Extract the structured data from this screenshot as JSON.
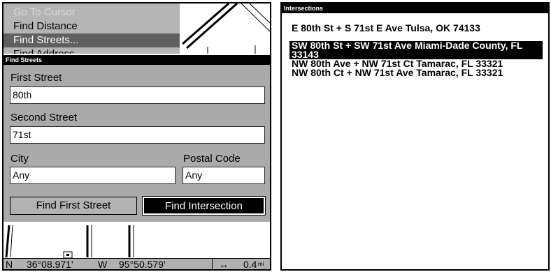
{
  "left": {
    "menu": {
      "items": [
        {
          "label": "Go To Cursor",
          "state": "disabled"
        },
        {
          "label": "Find Distance",
          "state": "normal"
        },
        {
          "label": "Find Streets...",
          "state": "selected"
        },
        {
          "label": "Find Address",
          "state": "normal"
        }
      ]
    },
    "dialog": {
      "title": "Find Streets",
      "first_street": {
        "label": "First Street",
        "value": "80th"
      },
      "second_street": {
        "label": "Second Street",
        "value": "71st"
      },
      "city": {
        "label": "City",
        "value": "Any"
      },
      "postal": {
        "label": "Postal Code",
        "value": "Any"
      },
      "buttons": {
        "find_first": "Find First Street",
        "find_intersection": "Find Intersection"
      }
    },
    "status": {
      "lat_hemi": "N",
      "lat": "36°08.971'",
      "lon_hemi": "W",
      "lon": "95°50.579'",
      "scale_icon": "↔",
      "scale": "0.4",
      "scale_unit": "mi"
    }
  },
  "right": {
    "title": "Intersections",
    "results": [
      "E 80th St + S 71st E Ave Tulsa, OK  74133",
      "SW 80th St + SW 71st Ave Miami-Dade County, FL  33143",
      "NW 80th Ave + NW 71st Ct Tamarac, FL  33321",
      "NW 80th Ct + NW 71st Ave Tamarac, FL  33321"
    ],
    "selected_index": 1
  },
  "colors": {
    "highlight": "#000000",
    "menu_selected": "#5f5f5f",
    "dialog_bg": "#aaaaaa"
  }
}
